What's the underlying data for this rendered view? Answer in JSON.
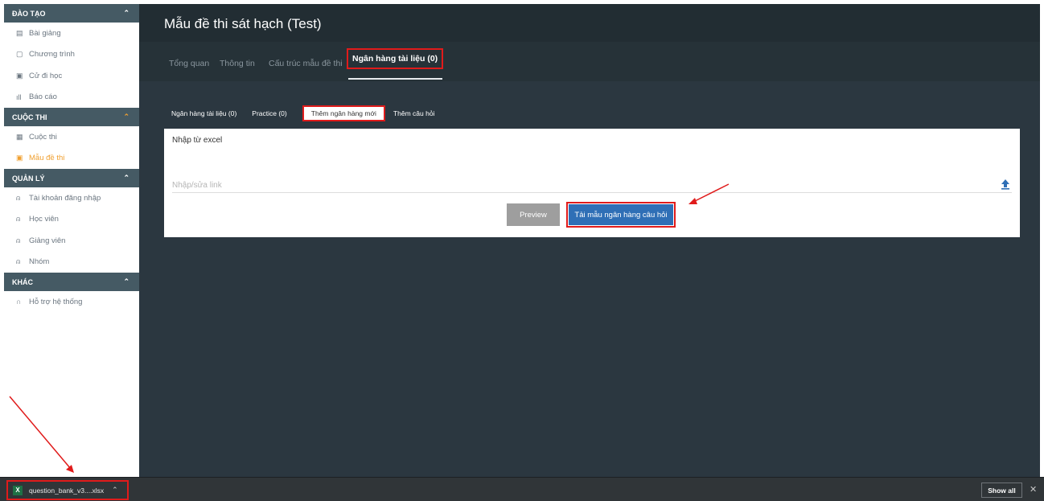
{
  "sidebar": {
    "sections": [
      {
        "title": "ĐÀO TẠO",
        "items": [
          {
            "icon": "book-icon",
            "glyph": "▤",
            "label": "Bài giảng"
          },
          {
            "icon": "document-icon",
            "glyph": "▢",
            "label": "Chương trình"
          },
          {
            "icon": "id-card-icon",
            "glyph": "▣",
            "label": "Cử đi học"
          },
          {
            "icon": "bar-chart-icon",
            "glyph": "ıll",
            "label": "Báo cáo"
          }
        ]
      },
      {
        "title": "CUỘC THI",
        "items": [
          {
            "icon": "calendar-icon",
            "glyph": "▦",
            "label": "Cuộc thi"
          },
          {
            "icon": "file-icon",
            "glyph": "▣",
            "label": "Mẫu đề thi"
          }
        ]
      },
      {
        "title": "QUẢN LÝ",
        "items": [
          {
            "icon": "user-icon",
            "glyph": "⍝",
            "label": "Tài khoản đăng nhập"
          },
          {
            "icon": "users-icon",
            "glyph": "⍝",
            "label": "Học viên"
          },
          {
            "icon": "user-icon",
            "glyph": "⍝",
            "label": "Giảng viên"
          },
          {
            "icon": "users-icon",
            "glyph": "⍝",
            "label": "Nhóm"
          }
        ]
      },
      {
        "title": "KHÁC",
        "items": [
          {
            "icon": "headset-icon",
            "glyph": "∩",
            "label": "Hỗ trợ hệ thống"
          }
        ]
      }
    ],
    "active_item": "Mẫu đề thi",
    "accent_color": "#f0a030"
  },
  "header": {
    "title": "Mẫu đề thi sát hạch (Test)"
  },
  "tabs": {
    "items": [
      "Tổng quan",
      "Thông tin",
      "Cấu trúc mẫu đề thi"
    ],
    "active": "Ngân hàng tài liệu (0)"
  },
  "subtabs": {
    "first": "Ngân hàng tài liệu (0)",
    "second": "Practice (0)",
    "active": "Thêm ngân hàng mới",
    "last": "Thêm câu hỏi"
  },
  "panel": {
    "title": "Nhập từ excel",
    "link_placeholder": "Nhập/sửa link",
    "preview_label": "Preview",
    "download_label": "Tải mẫu ngân hàng câu hỏi",
    "primary_color": "#2f6fb6"
  },
  "download_bar": {
    "file_name": "question_bank_v3....xlsx",
    "show_all_label": "Show all",
    "close_glyph": "✕"
  },
  "annotation_color": "#e01b1b"
}
